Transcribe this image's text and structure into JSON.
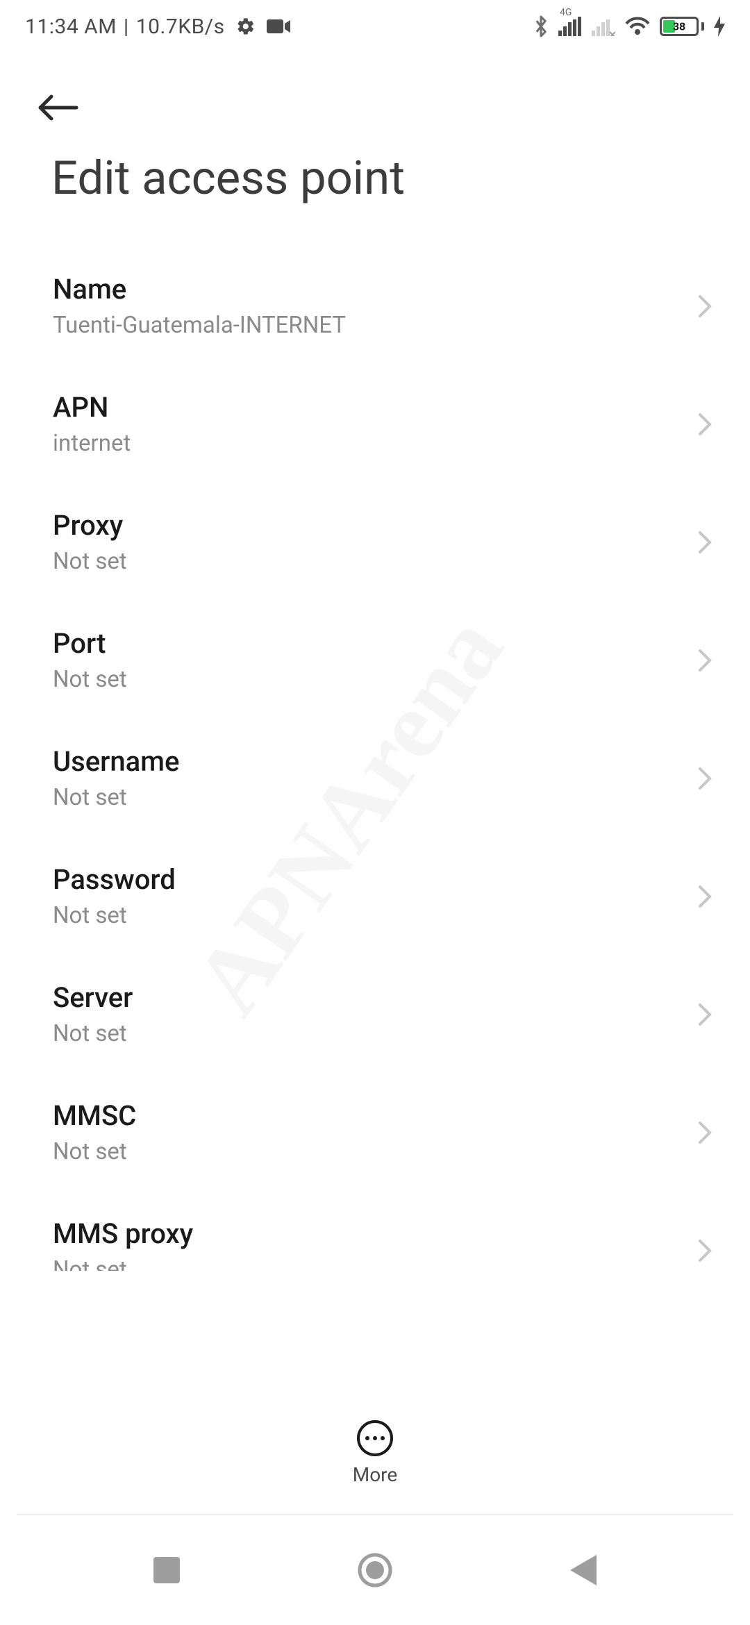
{
  "status": {
    "time": "11:34 AM",
    "separator": " | ",
    "speed": "10.7KB/s",
    "network_label_4g": "4G",
    "battery_percent": "38"
  },
  "header": {
    "title": "Edit access point"
  },
  "rows": [
    {
      "label": "Name",
      "value": "Tuenti-Guatemala-INTERNET"
    },
    {
      "label": "APN",
      "value": "internet"
    },
    {
      "label": "Proxy",
      "value": "Not set"
    },
    {
      "label": "Port",
      "value": "Not set"
    },
    {
      "label": "Username",
      "value": "Not set"
    },
    {
      "label": "Password",
      "value": "Not set"
    },
    {
      "label": "Server",
      "value": "Not set"
    },
    {
      "label": "MMSC",
      "value": "Not set"
    },
    {
      "label": "MMS proxy",
      "value": "Not set"
    }
  ],
  "bottom": {
    "more_label": "More"
  }
}
